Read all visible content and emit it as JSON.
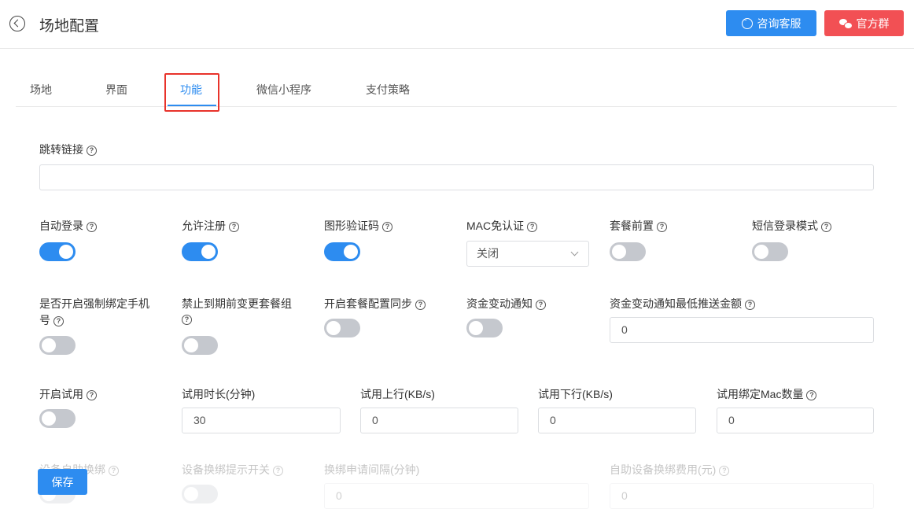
{
  "header": {
    "title": "场地配置",
    "service_label": "咨询客服",
    "group_label": "官方群"
  },
  "tabs": [
    {
      "label": "场地"
    },
    {
      "label": "界面"
    },
    {
      "label": "功能"
    },
    {
      "label": "微信小程序"
    },
    {
      "label": "支付策略"
    }
  ],
  "form": {
    "jump_link": {
      "label": "跳转链接",
      "value": ""
    },
    "auto_login": {
      "label": "自动登录",
      "on": true
    },
    "allow_register": {
      "label": "允许注册",
      "on": true
    },
    "captcha": {
      "label": "图形验证码",
      "on": true
    },
    "mac_auth": {
      "label": "MAC免认证",
      "value": "关闭"
    },
    "package_first": {
      "label": "套餐前置",
      "on": false
    },
    "sms_login": {
      "label": "短信登录模式",
      "on": false
    },
    "force_bind_phone": {
      "label_line1": "是否开启强制绑定手机",
      "label_line2": "号",
      "on": false
    },
    "forbid_change": {
      "label": "禁止到期前变更套餐组",
      "on": false
    },
    "sync_package": {
      "label": "开启套餐配置同步",
      "on": false
    },
    "fund_notice": {
      "label": "资金变动通知",
      "on": false
    },
    "fund_min_amount": {
      "label": "资金变动通知最低推送金额",
      "value": "0"
    },
    "trial_enable": {
      "label": "开启试用",
      "on": false
    },
    "trial_duration": {
      "label": "试用时长(分钟)",
      "value": "30"
    },
    "trial_up": {
      "label": "试用上行(KB/s)",
      "value": "0"
    },
    "trial_down": {
      "label": "试用下行(KB/s)",
      "value": "0"
    },
    "trial_mac_count": {
      "label": "试用绑定Mac数量",
      "value": "0"
    },
    "device_self_rebind": {
      "label": "设备自助换绑",
      "on": false
    },
    "rebind_prompt": {
      "label": "设备换绑提示开关",
      "on": false
    },
    "rebind_interval": {
      "label": "换绑申请间隔(分钟)",
      "value": "0"
    },
    "rebind_fee": {
      "label": "自助设备换绑费用(元)",
      "value": "0"
    }
  },
  "footer": {
    "save_label": "保存"
  },
  "colors": {
    "primary": "#2d8cf0",
    "danger": "#f25054",
    "switch_off": "#c5c8ce"
  }
}
